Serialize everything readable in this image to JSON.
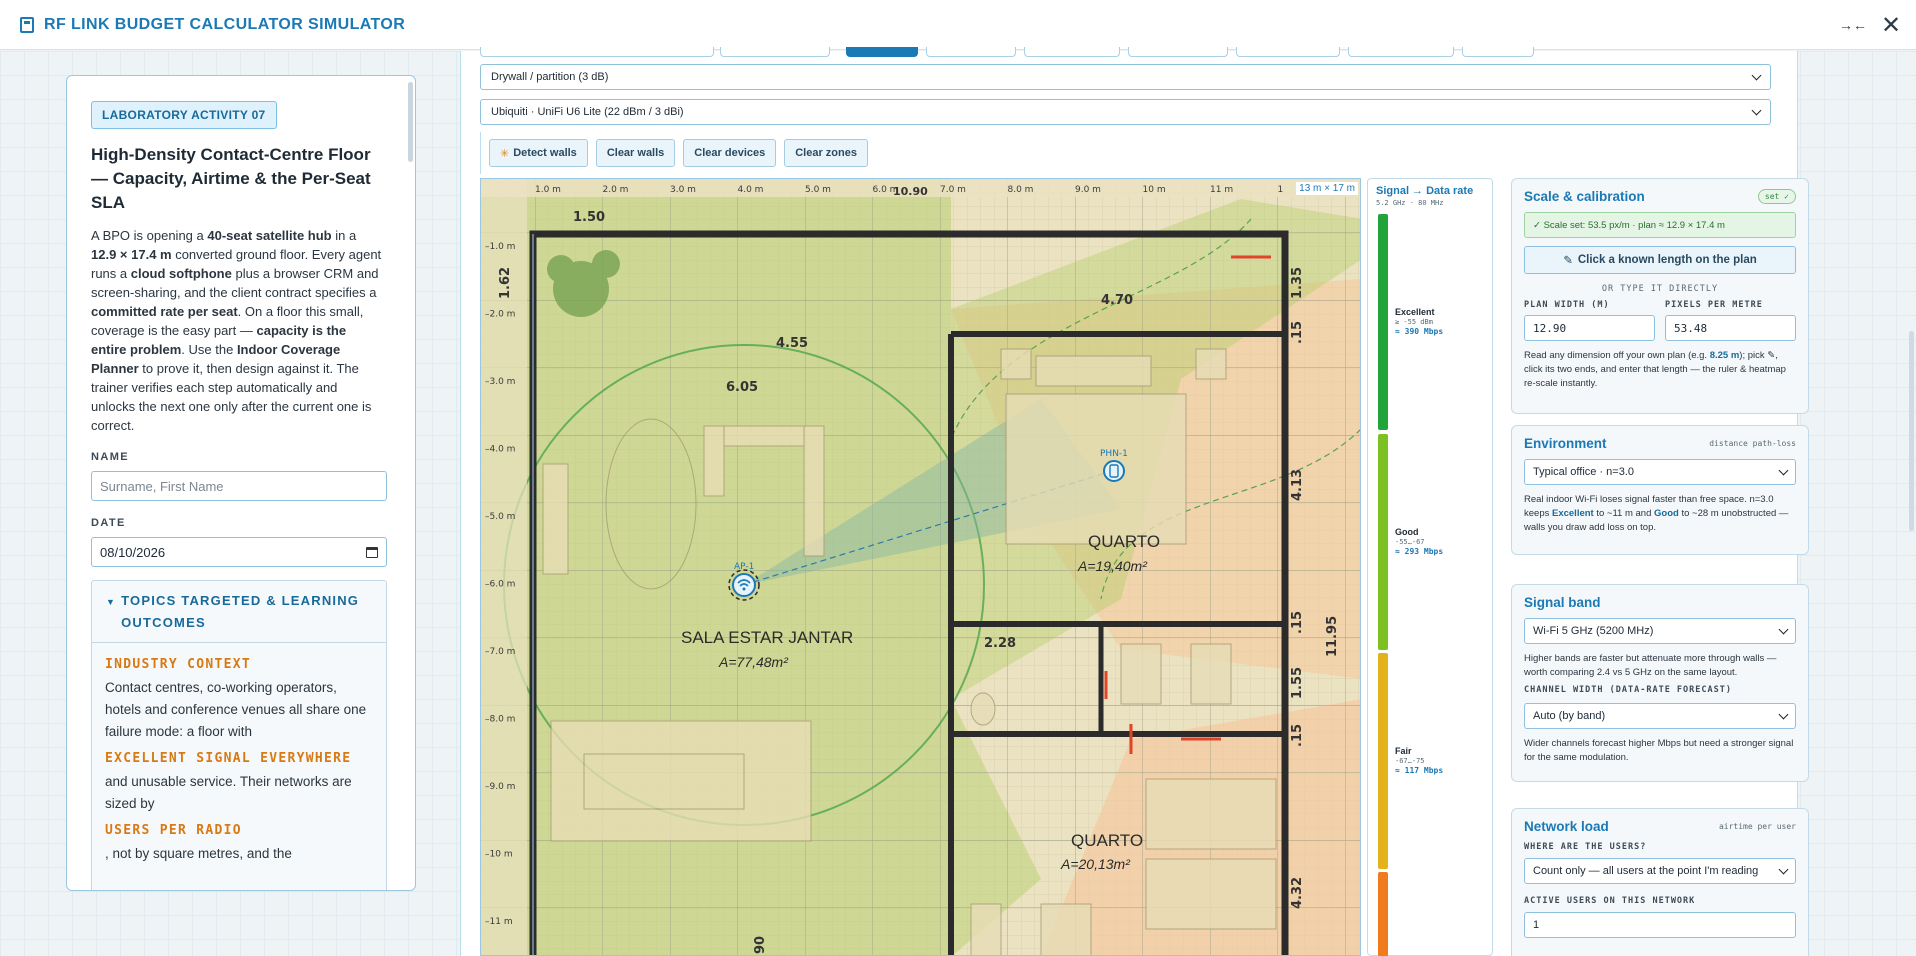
{
  "app": {
    "title": "RF LINK BUDGET CALCULATOR SIMULATOR"
  },
  "activity": {
    "badge": "LABORATORY ACTIVITY 07",
    "title": "High-Density Contact-Centre Floor — Capacity, Airtime & the Per-Seat SLA",
    "desc_parts": [
      {
        "t": "A BPO is opening a ",
        "b": false
      },
      {
        "t": "40-seat satellite hub",
        "b": true
      },
      {
        "t": " in a ",
        "b": false
      },
      {
        "t": "12.9 × 17.4 m",
        "b": true
      },
      {
        "t": " converted ground floor. Every agent runs a ",
        "b": false
      },
      {
        "t": "cloud softphone",
        "b": true
      },
      {
        "t": " plus a browser CRM and screen-sharing, and the client contract specifies a ",
        "b": false
      },
      {
        "t": "committed rate per seat",
        "b": true
      },
      {
        "t": ". On a floor this small, coverage is the easy part — ",
        "b": false
      },
      {
        "t": "capacity is the entire problem",
        "b": true
      },
      {
        "t": ". Use the ",
        "b": false
      },
      {
        "t": "Indoor Coverage Planner",
        "b": true
      },
      {
        "t": " to prove it, then design against it. The trainer verifies each step automatically and unlocks the next one only after the current one is correct.",
        "b": false
      }
    ],
    "name_label": "NAME",
    "name_placeholder": "Surname, First Name",
    "date_label": "DATE",
    "date_value": "08/10/2026",
    "topics_title": "TOPICS TARGETED & LEARNING OUTCOMES",
    "industry_heading": "INDUSTRY CONTEXT",
    "industry_text": "Contact centres, co-working operators, hotels and conference venues all share one failure mode: a floor with",
    "excellent_heading": "EXCELLENT SIGNAL EVERYWHERE",
    "excellent_text": "and unusable service. Their networks are sized by",
    "users_heading": "USERS PER RADIO",
    "users_text": ", not by square metres, and the"
  },
  "controls": {
    "wall_material": "Drywall / partition (3 dB)",
    "device_model": "Ubiquiti · UniFi U6 Lite (22 dBm / 3 dBi)",
    "btn_detect": "Detect walls",
    "btn_clear_walls": "Clear walls",
    "btn_clear_devices": "Clear devices",
    "btn_clear_zones": "Clear zones"
  },
  "plan": {
    "size_label": "13 m × 17 m",
    "ruler_x": [
      "1.0 m",
      "2.0 m",
      "3.0 m",
      "4.0 m",
      "5.0 m",
      "6.0 m",
      "7.0 m",
      "8.0 m",
      "9.0 m",
      "10 m",
      "11 m",
      "1"
    ],
    "ruler_y": [
      "1.0 m",
      "2.0 m",
      "3.0 m",
      "4.0 m",
      "5.0 m",
      "6.0 m",
      "7.0 m",
      "8.0 m",
      "9.0 m",
      "10 m",
      "11 m"
    ],
    "dims": {
      "d150": "1.50",
      "d1090": "10.90",
      "d162": "1.62",
      "d470": "4.70",
      "d455": "4.55",
      "d605": "6.05",
      "d228": "2.28",
      "d135": "1.35",
      "d15a": ".15",
      "d413": "4.13",
      "d15b": ".15",
      "d1195": "11.95",
      "d155": "1.55",
      "d15c": ".15",
      "d432": "4.32",
      "d90": "90"
    },
    "rooms": {
      "living_name": "SALA ESTAR JANTAR",
      "living_area": "A=77,48m²",
      "quarto1_name": "QUARTO",
      "quarto1_area": "A=19,40m²",
      "quarto2_name": "QUARTO",
      "quarto2_area": "A=20,13m²"
    },
    "ap_label": "AP-1",
    "phone_label": "PHN-1"
  },
  "legend": {
    "title": "Signal → Data rate",
    "sub": "5.2 GHz · 80 MHz",
    "entries": [
      {
        "name": "Excellent",
        "dbm": "≥ -55 dBm",
        "rate": "≈ 390 Mbps",
        "color": "#22a43a"
      },
      {
        "name": "Good",
        "dbm": "-55…-67",
        "rate": "≈ 293 Mbps",
        "color": "#7cc121"
      },
      {
        "name": "Fair",
        "dbm": "-67…-75",
        "rate": "≈ 117 Mbps",
        "color": "#e4b31b"
      },
      {
        "name": "",
        "dbm": "",
        "rate": "",
        "color": "#f07a1e"
      }
    ]
  },
  "scale": {
    "title": "Scale & calibration",
    "badge": "set ✓",
    "status": "✓ Scale set: 53.5 px/m · plan ≈ 12.9 × 17.4 m",
    "click_btn": "Click a known length on the plan",
    "or_text": "OR TYPE IT DIRECTLY",
    "width_label": "PLAN WIDTH (M)",
    "width_value": "12.90",
    "ppm_label": "PIXELS PER METRE",
    "ppm_value": "53.48",
    "note_pre": "Read any dimension off your own plan (e.g. ",
    "note_bold": "8.25 m",
    "note_post": "); pick ✎, click its two ends, and enter that length — the ruler & heatmap re-scale instantly."
  },
  "environment": {
    "title": "Environment",
    "tag": "distance path-loss",
    "select": "Typical office · n=3.0",
    "note_pre": "Real indoor Wi-Fi loses signal faster than free space. n=3.0 keeps ",
    "note_b1": "Excellent",
    "note_mid": " to ~11 m and ",
    "note_b2": "Good",
    "note_post": " to ~28 m unobstructed — walls you draw add loss on top."
  },
  "band": {
    "title": "Signal band",
    "select": "Wi-Fi 5 GHz (5200 MHz)",
    "note": "Higher bands are faster but attenuate more through walls — worth comparing 2.4 vs 5 GHz on the same layout.",
    "cw_label": "CHANNEL WIDTH (DATA-RATE FORECAST)",
    "cw_select": "Auto (by band)",
    "cw_note": "Wider channels forecast higher Mbps but need a stronger signal for the same modulation."
  },
  "load": {
    "title": "Network load",
    "tag": "airtime per user",
    "where_label": "WHERE ARE THE USERS?",
    "where_select": "Count only — all users at the point I'm reading",
    "active_label": "ACTIVE USERS ON THIS NETWORK",
    "active_value": "1"
  }
}
